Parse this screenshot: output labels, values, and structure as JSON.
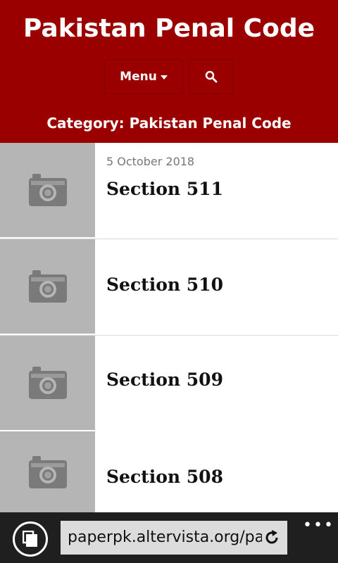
{
  "header": {
    "site_title": "Pakistan Penal Code",
    "menu_label": "Menu",
    "category_title": "Category: Pakistan Penal Code",
    "background_color": "#9b0000"
  },
  "posts": [
    {
      "date": "5 October 2018",
      "title": "Section 511",
      "thumbnail_icon": "camera-icon"
    },
    {
      "date": "",
      "title": "Section 510",
      "thumbnail_icon": "camera-icon"
    },
    {
      "date": "",
      "title": "Section 509",
      "thumbnail_icon": "camera-icon"
    },
    {
      "date": "",
      "title": "Section 508",
      "thumbnail_icon": "camera-icon"
    }
  ],
  "browser": {
    "url": "paperpk.altervista.org/pa",
    "tabs_icon": "tabs-icon",
    "refresh_icon": "refresh-icon",
    "more_label": "•••"
  }
}
